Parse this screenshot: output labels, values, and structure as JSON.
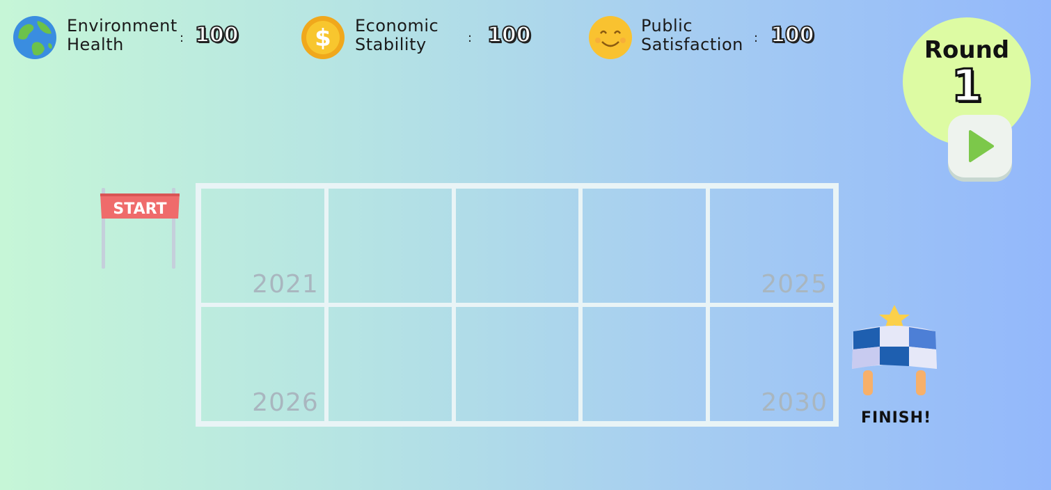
{
  "stats": {
    "environment": {
      "label_line1": "Environment",
      "label_line2": "Health",
      "colon": ":",
      "value": "100",
      "icon": "earth-icon"
    },
    "economic": {
      "label_line1": "Economic",
      "label_line2": "Stability",
      "colon": ":",
      "value": "100",
      "icon": "gold-coin-icon"
    },
    "public": {
      "label_line1": "Public",
      "label_line2": "Satisfaction",
      "colon": ":",
      "value": "100",
      "icon": "smiley-face-icon"
    }
  },
  "round": {
    "label": "Round",
    "number": "1"
  },
  "play_button": {
    "icon": "play-icon"
  },
  "start": {
    "label": "START"
  },
  "finish": {
    "label": "FINISH!"
  },
  "board": {
    "rows": [
      [
        "2021",
        "",
        "",
        "",
        "2025"
      ],
      [
        "2026",
        "",
        "",
        "",
        "2030"
      ]
    ]
  },
  "colors": {
    "round_circle": "#ddfba3",
    "play_triangle": "#7cc84a",
    "start_banner": "#ef6b6b",
    "grid_lines": "#e9f4f6",
    "year_text": "#a9b6bf"
  }
}
